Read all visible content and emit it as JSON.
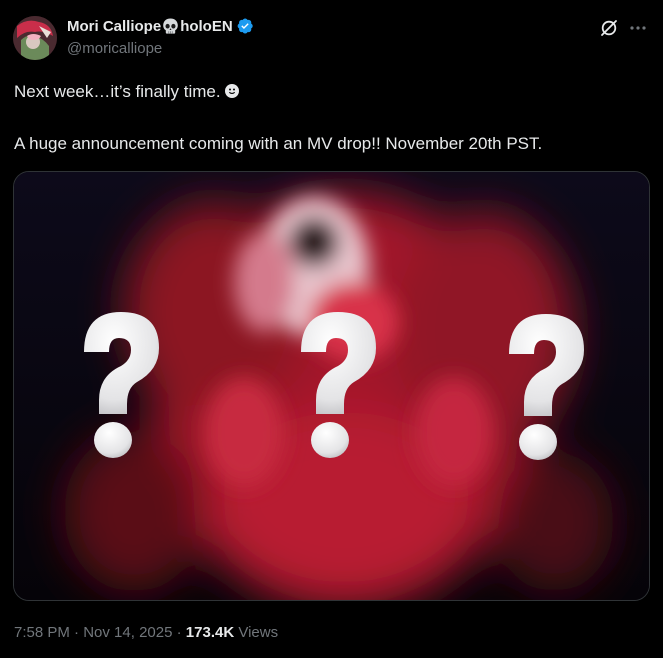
{
  "post": {
    "author": {
      "display_name_prefix": "Mori Calliope",
      "display_name_suffix": "holoEN",
      "name_emoji_icon": "skull-icon",
      "verified_icon": "verified-badge-icon",
      "handle": "@moricalliope",
      "avatar_icon": "avatar"
    },
    "actions": {
      "grok_icon": "grok-icon",
      "more_icon": "more-horizontal-icon"
    },
    "text_line_1": "Next week…it’s finally time.",
    "text_line_2": "A huge announcement coming with an MV drop!! November 20th PST.",
    "media": {
      "description_icon": "image",
      "overlay_glyphs": [
        "?",
        "?",
        "?"
      ]
    },
    "meta": {
      "time": "7:58 PM",
      "separator": "·",
      "date": "Nov 14, 2025",
      "views_count": "173.4K",
      "views_label": "Views"
    }
  },
  "colors": {
    "background": "#000000",
    "text_primary": "#e7e9ea",
    "text_secondary": "#71767b",
    "verified_blue": "#1d9bf0",
    "media_red": "#c81e32"
  }
}
